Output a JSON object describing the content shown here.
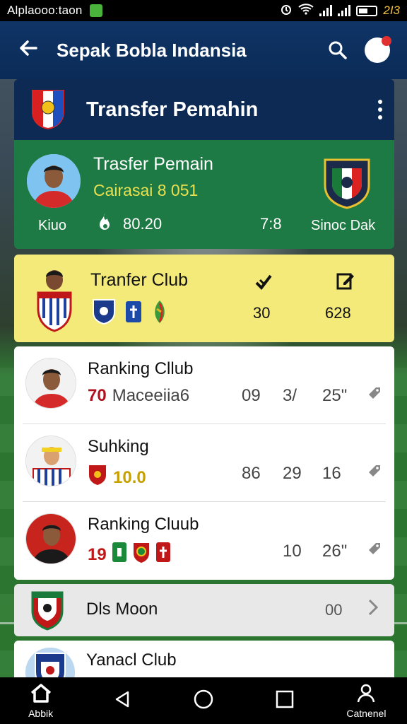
{
  "status_bar": {
    "carrier": "Alplaooo:taon",
    "time": "2I3"
  },
  "app_bar": {
    "title": "Sepak Bobla Indansia"
  },
  "header_card": {
    "title": "Transfer Pemahin"
  },
  "featured_transfer": {
    "title": "Trasfer Pemain",
    "subtitle": "Cairasai 8 051",
    "left_label": "Kiuo",
    "value_one": "80.20",
    "value_two": "7:8",
    "club_label": "Sinoc Dak"
  },
  "club_transfer": {
    "title": "Tranfer Club",
    "value_one": "30",
    "value_two": "628"
  },
  "rankings": [
    {
      "name": "Ranking Cllub",
      "code": "70",
      "sub": "Maceeiia6",
      "stats": [
        "09",
        "3/",
        "25\""
      ]
    },
    {
      "name": "Suhking",
      "score": "10.0",
      "stats": [
        "86",
        "29",
        "16"
      ]
    },
    {
      "name": "Ranking Cluub",
      "score": "19",
      "stats": [
        "10",
        "26\""
      ]
    }
  ],
  "dis_moon": {
    "name": "Dls Moon",
    "value": "00"
  },
  "partial_row": {
    "name": "Yanacl Club"
  },
  "bottom_nav": {
    "home_label": "Abbik",
    "profile_label": "Catnenel"
  },
  "colors": {
    "app_bar": "#0f3466",
    "featured": "#1e7a44",
    "club_card": "#f3ea7a",
    "accent_red": "#c01818"
  }
}
